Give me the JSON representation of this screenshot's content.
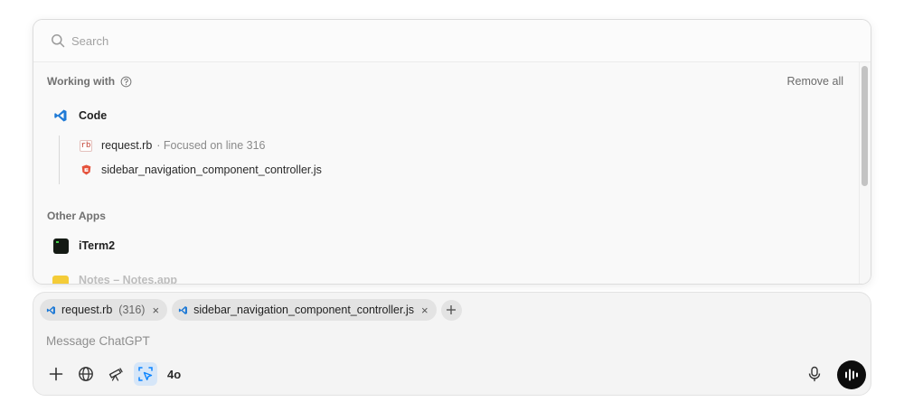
{
  "search": {
    "placeholder": "Search"
  },
  "working_with": {
    "heading": "Working with",
    "remove_all_label": "Remove all",
    "app": {
      "name": "Code",
      "icon": "vscode-icon"
    },
    "files": [
      {
        "icon": "ruby-file-icon",
        "icon_text": "rb",
        "name": "request.rb",
        "meta": "· Focused on line 316"
      },
      {
        "icon": "stimulus-file-icon",
        "name": "sidebar_navigation_component_controller.js",
        "meta": ""
      }
    ]
  },
  "other_apps": {
    "heading": "Other Apps",
    "items": [
      {
        "name": "iTerm2",
        "icon": "iterm-icon"
      },
      {
        "name": "Notes – Notes.app",
        "icon": "notes-icon"
      }
    ]
  },
  "composer": {
    "chips": [
      {
        "name": "request.rb",
        "line": "(316)",
        "close": "×"
      },
      {
        "name": "sidebar_navigation_component_controller.js",
        "close": "×"
      }
    ],
    "placeholder": "Message ChatGPT",
    "model_label": "4o",
    "tools": [
      "plus-icon",
      "globe-icon",
      "telescope-icon",
      "pointer-select-icon"
    ]
  },
  "colors": {
    "accent_blue": "#0a84ff",
    "vscode_blue": "#1f7ad6",
    "chip_bg": "#e3e3e3",
    "voice_button": "#0d0d0d"
  }
}
